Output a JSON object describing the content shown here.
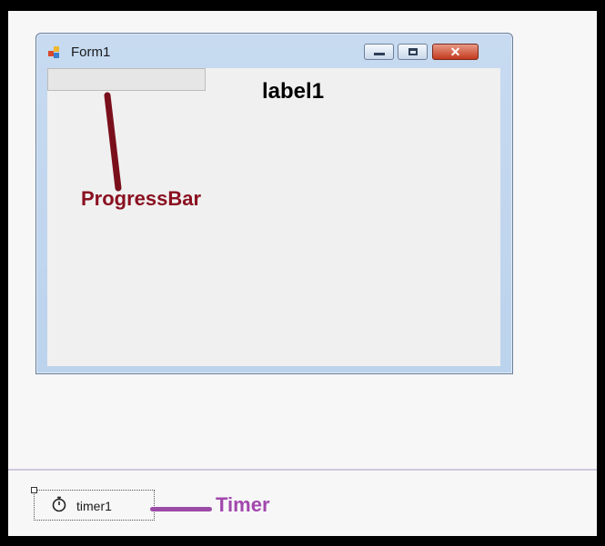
{
  "form": {
    "title": "Form1",
    "label_text": "label1",
    "progress_value": 0
  },
  "annotations": {
    "progressbar_label": "ProgressBar",
    "timer_label": "Timer"
  },
  "component_tray": {
    "timer_name": "timer1"
  },
  "colors": {
    "progress_annotation": "#8a1020",
    "timer_annotation": "#a247ad",
    "close_button": "#c33a1d"
  }
}
